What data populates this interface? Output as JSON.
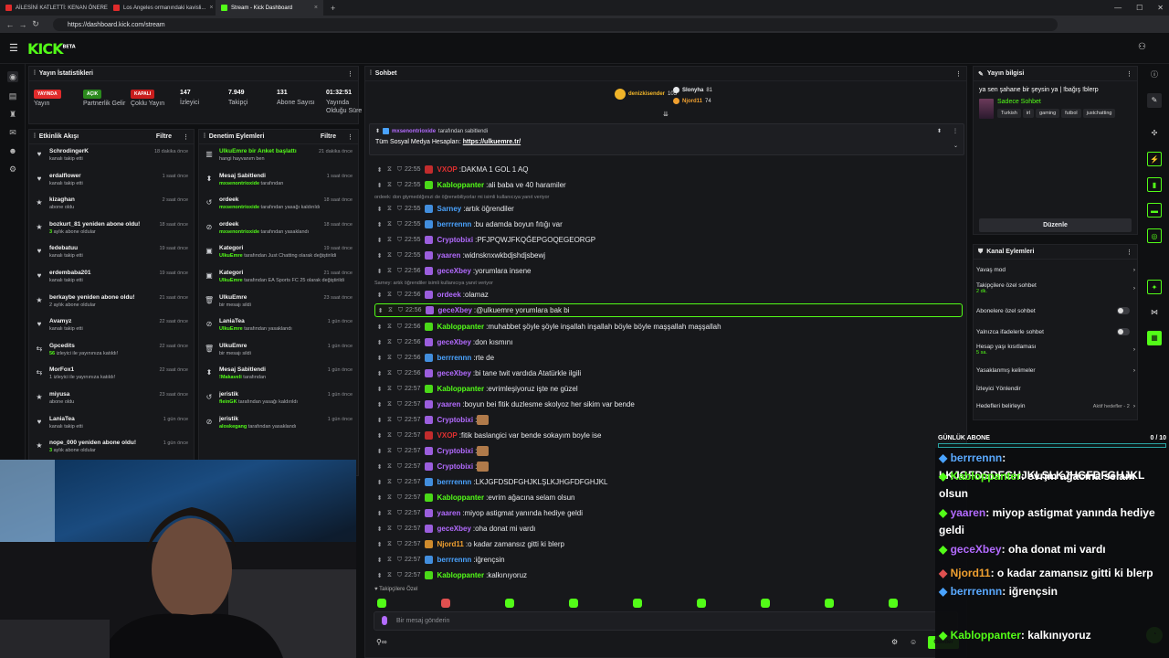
{
  "browser": {
    "tabs": [
      {
        "title": "AİLESİNİ KATLETTİ: KENAN ÖNEREN",
        "icon": "youtube-icon",
        "color": "#e02b2b"
      },
      {
        "title": "Los Angeles ormanındaki kavisli...",
        "icon": "youtube-icon",
        "color": "#e02b2b"
      },
      {
        "title": "Stream - Kick Dashboard",
        "icon": "kick-icon",
        "color": "#53fc18",
        "active": true
      }
    ],
    "url": "https://dashboard.kick.com/stream"
  },
  "app": {
    "logo": "KICK",
    "beta": "BETA"
  },
  "stats": {
    "title": "Yayın İstatistikleri",
    "items": [
      {
        "badge": "YAYINDA",
        "badge_color": "#e02b2b",
        "label": "Yayın"
      },
      {
        "badge": "AÇIK",
        "badge_color": "#2b8a1d",
        "label": "Partnerlik Gelir"
      },
      {
        "badge": "KAPALI",
        "badge_color": "#c81d1d",
        "label": "Çoklu Yayın"
      },
      {
        "value": "147",
        "label": "İzleyici"
      },
      {
        "value": "7.949",
        "label": "Takipçi"
      },
      {
        "value": "131",
        "label": "Abone Sayısı"
      },
      {
        "value": "01:32:51",
        "label": "Yayında Olduğu Süre"
      }
    ]
  },
  "activity": {
    "title": "Etkinlik Akışı",
    "filter": "Filtre",
    "items": [
      {
        "icon": "heart-icon",
        "name": "SchrodingerK",
        "sub": "kanalı takip etti",
        "when": "18 dakika önce"
      },
      {
        "icon": "heart-icon",
        "name": "erdalflower",
        "sub": "kanalı takip etti",
        "when": "1 saat önce"
      },
      {
        "icon": "star-icon",
        "name": "kizaghan",
        "sub": "abone oldu",
        "when": "2 saat önce"
      },
      {
        "icon": "star-icon",
        "name": "bozkurt_81 yeniden abone oldu!",
        "sub_hl": "3",
        "sub": " aylık abone oldular",
        "when": "18 saat önce"
      },
      {
        "icon": "heart-icon",
        "name": "fedebatuu",
        "sub": "kanalı takip etti",
        "when": "19 saat önce"
      },
      {
        "icon": "heart-icon",
        "name": "erdembaba201",
        "sub": "kanalı takip etti",
        "when": "19 saat önce"
      },
      {
        "icon": "star-icon",
        "name": "berkaybe yeniden abone oldu!",
        "sub_hl": "",
        "sub": "2 aylık abone oldular",
        "when": "21 saat önce"
      },
      {
        "icon": "heart-icon",
        "name": "Avamyz",
        "sub": "kanalı takip etti",
        "when": "22 saat önce"
      },
      {
        "icon": "host-icon",
        "name": "Gpcedits",
        "sub_hl": "56",
        "sub": " izleyici ile yayınınıza katıldı!",
        "when": "22 saat önce"
      },
      {
        "icon": "host-icon",
        "name": "MorFox1",
        "sub_hl": "",
        "sub": "1 izleyici ile yayınınıza katıldı!",
        "when": "22 saat önce"
      },
      {
        "icon": "star-icon",
        "name": "miyusa",
        "sub": "abone oldu",
        "when": "23 saat önce"
      },
      {
        "icon": "heart-icon",
        "name": "LaniaTea",
        "sub": "kanalı takip etti",
        "when": "1 gün önce"
      },
      {
        "icon": "star-icon",
        "name": "nope_000 yeniden abone oldu!",
        "sub_hl": "3",
        "sub": " aylık abone oldular",
        "when": "1 gün önce"
      }
    ]
  },
  "moderation": {
    "title": "Denetim Eylemleri",
    "filter": "Filtre",
    "items": [
      {
        "icon": "chart-icon",
        "name": "UlkuEmre bir Anket başlattı",
        "sub": "hangi hayvanım ben",
        "when": "21 dakika önce",
        "green": true
      },
      {
        "icon": "pin-icon",
        "name": "Mesaj Sabitlendi",
        "sub_hl": "mxsenontrioxide",
        "sub": " tarafından",
        "when": "1 saat önce"
      },
      {
        "icon": "undo-icon",
        "name": "ordeek",
        "sub_hl": "mxsenontrioxide",
        "sub": " tarafından yasağı kaldırıldı",
        "when": "18 saat önce"
      },
      {
        "icon": "ban-icon",
        "name": "ordeek",
        "sub_hl": "mxsenontrioxide",
        "sub": " tarafından yasaklandı",
        "when": "18 saat önce"
      },
      {
        "icon": "category-icon",
        "name": "Kategori",
        "sub_hl": "UlkuEmre",
        "sub": " tarafından Just Chatting olarak değiştirildi",
        "when": "19 saat önce"
      },
      {
        "icon": "category-icon",
        "name": "Kategori",
        "sub_hl": "UlkuEmre",
        "sub": " tarafından EA Sports FC 25 olarak değiştirildi",
        "when": "21 saat önce"
      },
      {
        "icon": "trash-icon",
        "name": "UlkuEmre",
        "sub": "bir mesajı sildi",
        "when": "23 saat önce"
      },
      {
        "icon": "ban-icon",
        "name": "LaniaTea",
        "sub_hl": "UlkuEmre",
        "sub": " tarafından yasaklandı",
        "when": "1 gün önce"
      },
      {
        "icon": "trash-icon",
        "name": "UlkuEmre",
        "sub": "bir mesajı sildi",
        "when": "1 gün önce"
      },
      {
        "icon": "pin-icon",
        "name": "Mesaj Sabitlendi",
        "sub_hl": "!Makaveli",
        "sub": " tarafından",
        "when": "1 gün önce"
      },
      {
        "icon": "undo-icon",
        "name": "jeristik",
        "sub_hl": "fleinGK",
        "sub": " tarafından yasağı kaldırıldı",
        "when": "1 gün önce"
      },
      {
        "icon": "ban-icon",
        "name": "jeristik",
        "sub_hl": "aloskegang",
        "sub": " tarafından yasaklandı",
        "when": "1 gün önce"
      }
    ]
  },
  "chat": {
    "title": "Sohbet",
    "top_gifters": [
      {
        "name": "denizkisender",
        "count": "105",
        "color": "#f0b429"
      },
      {
        "name": "Slonyha",
        "count": "81",
        "color": "#e7e9ec"
      },
      {
        "name": "Njord11",
        "count": "74",
        "color": "#f0a030"
      }
    ],
    "pinned": {
      "by": "mxsenontrioxide",
      "by_suffix": "tarafından sabitlendi",
      "text": "Tüm Sosyal Medya Hesapları:",
      "link": "https://ulkuemre.tr/"
    },
    "messages": [
      {
        "time": "22:55",
        "user": "VXOP",
        "color": "#e03030",
        "text": "DAKMA 1 GOL 1 AQ"
      },
      {
        "time": "22:55",
        "user": "Kabloppanter",
        "color": "#53fc18",
        "text": "ali baba ve 40 haramiler"
      },
      {
        "reply": "ordeek: don gtymedılğınızi de öğrenebiliyorlar mi isimli kullanıcıya yanıt veriyor"
      },
      {
        "time": "22:55",
        "user": "Sarney",
        "color": "#4aa3ff",
        "text": "artık öğrendiler"
      },
      {
        "time": "22:55",
        "user": "berrrennn",
        "color": "#4aa3ff",
        "text": "bu adamda boyun fıtığı var"
      },
      {
        "time": "22:55",
        "user": "Cryptobixi",
        "color": "#b36bff",
        "text": "PFJPQWJFKQĞEPGOQEGEORGP"
      },
      {
        "time": "22:55",
        "user": "yaaren",
        "color": "#b36bff",
        "text": "widnsknxwkbdjshdjsbewj"
      },
      {
        "time": "22:56",
        "user": "geceXbey",
        "color": "#b36bff",
        "text": "yorumlara insene"
      },
      {
        "reply": "Sarney: artık öğrendiler isimli kullanıcıya yanıt veriyor"
      },
      {
        "time": "22:56",
        "user": "ordeek",
        "color": "#b36bff",
        "text": "olamaz"
      },
      {
        "time": "22:56",
        "user": "geceXbey",
        "color": "#b36bff",
        "text": "@ulkuemre yorumlara bak bi",
        "highlight": true
      },
      {
        "time": "22:56",
        "user": "Kabloppanter",
        "color": "#53fc18",
        "text": "muhabbet şöyle şöyle inşallah inşallah böyle böyle maşşallah maşşallah"
      },
      {
        "time": "22:56",
        "user": "geceXbey",
        "color": "#b36bff",
        "text": "don kısmını"
      },
      {
        "time": "22:56",
        "user": "berrrennn",
        "color": "#4aa3ff",
        "text": "rte de"
      },
      {
        "time": "22:56",
        "user": "geceXbey",
        "color": "#b36bff",
        "text": "bi tane twit vardıda Atatürkle ilgili"
      },
      {
        "time": "22:57",
        "user": "Kabloppanter",
        "color": "#53fc18",
        "text": "evrimleşiyoruz işte ne güzel"
      },
      {
        "time": "22:57",
        "user": "yaaren",
        "color": "#b36bff",
        "text": "boyun bei fitik duzlesme skolyoz her sikim var bende"
      },
      {
        "time": "22:57",
        "user": "Cryptobixi",
        "color": "#b36bff",
        "text": "",
        "emote": true
      },
      {
        "time": "22:57",
        "user": "VXOP",
        "color": "#e03030",
        "text": "fitik baslangici var bende sokayım boyle ise"
      },
      {
        "time": "22:57",
        "user": "Cryptobixi",
        "color": "#b36bff",
        "text": "",
        "emote": true
      },
      {
        "time": "22:57",
        "user": "Cryptobixi",
        "color": "#b36bff",
        "text": "",
        "emote": true
      },
      {
        "time": "22:57",
        "user": "berrrennn",
        "color": "#4aa3ff",
        "text": "LKJGFDSDFGHJKLŞLKJHGFDFGHJKL"
      },
      {
        "time": "22:57",
        "user": "Kabloppanter",
        "color": "#53fc18",
        "text": "evrim ağacına selam olsun"
      },
      {
        "time": "22:57",
        "user": "yaaren",
        "color": "#b36bff",
        "text": "miyop astigmat yanında hediye geldi"
      },
      {
        "time": "22:57",
        "user": "geceXbey",
        "color": "#b36bff",
        "text": "oha donat mi vardı"
      },
      {
        "time": "22:57",
        "user": "Njord11",
        "color": "#f0a030",
        "text": "o kadar zamansız gitti ki blerp"
      },
      {
        "time": "22:57",
        "user": "berrrennn",
        "color": "#4aa3ff",
        "text": "iğrençsin"
      },
      {
        "time": "22:57",
        "user": "Kabloppanter",
        "color": "#53fc18",
        "text": "kalkınıyoruz"
      }
    ],
    "followers_only": "Takipçilere Özel",
    "placeholder": "Bir mesaj gönderin",
    "send": "Gönder"
  },
  "info": {
    "title": "Yayın bilgisi",
    "stream_title": "ya sen şahane bir şeysin ya | !bağış !blerp",
    "mode": "Sadece Sohbet",
    "tags": [
      "Turkish",
      "irl",
      "gaming",
      "futbol",
      "justchatting"
    ],
    "edit": "Düzenle"
  },
  "actions": {
    "title": "Kanal Eylemleri",
    "items": [
      {
        "label": "Yavaş mod",
        "kind": "arrow"
      },
      {
        "label": "Takipçilere özel sohbet",
        "sub": "2 dk.",
        "kind": "arrow"
      },
      {
        "label": "Abonelere özel sohbet",
        "kind": "toggle"
      },
      {
        "label": "Yalnızca ifadelerle sohbet",
        "kind": "toggle"
      },
      {
        "label": "Hesap yaşı kısıtlaması",
        "sub": "5 sa.",
        "kind": "arrow"
      },
      {
        "label": "Yasaklanmış kelimeler",
        "kind": "arrow"
      },
      {
        "label": "İzleyici Yönlendir",
        "kind": "none"
      },
      {
        "label": "Hedefleri belirleyin",
        "extra": "Aktif hedefler - 2",
        "kind": "arrow"
      }
    ]
  },
  "overlay": {
    "goal_label": "GÜNLÜK ABONE",
    "goal_value": "0 / 10",
    "lines": [
      {
        "user": "berrrennn",
        "color": "#5aa9ff",
        "text": ": LKJGFDSDFGHJKLŞLKJHGFDFGHJKL"
      },
      {
        "user": "Kabloppanter",
        "color": "#53fc18",
        "text": ": evrim ağacına selam olsun"
      },
      {
        "user": "yaaren",
        "color": "#b36bff",
        "text": ": miyop astigmat yanında hediye geldi"
      },
      {
        "user": "geceXbey",
        "color": "#b36bff",
        "text": ": oha donat mi vardı"
      },
      {
        "user": "Njord11",
        "color": "#f0a030",
        "text": ": o kadar zamansız gitti ki blerp"
      },
      {
        "user": "berrrennn",
        "color": "#5aa9ff",
        "text": ": iğrençsin"
      },
      {
        "user": "Kabloppanter",
        "color": "#53fc18",
        "text": ": kalkınıyoruz"
      }
    ]
  }
}
